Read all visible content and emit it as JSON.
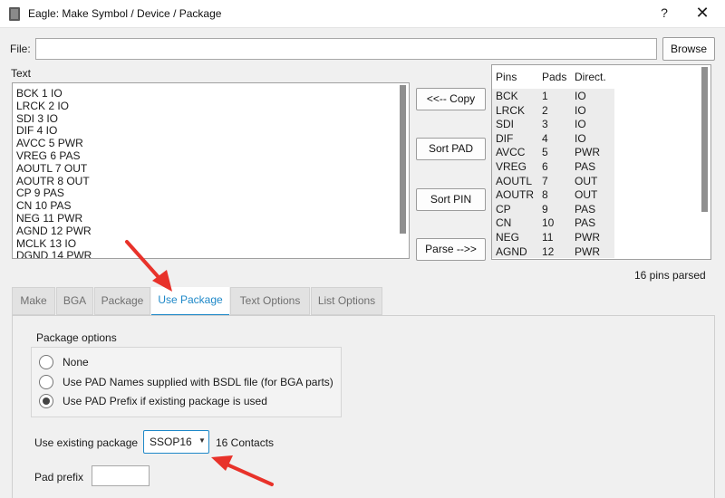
{
  "window": {
    "title": "Eagle: Make Symbol / Device / Package",
    "help_label": "?",
    "close_label": "✕"
  },
  "file": {
    "label": "File:",
    "value": "",
    "browse_label": "Browse"
  },
  "text_panel": {
    "label": "Text",
    "lines": [
      "BCK 1 IO",
      "LRCK 2 IO",
      "SDI 3 IO",
      "DIF 4 IO",
      "AVCC 5 PWR",
      "VREG 6 PAS",
      "AOUTL 7 OUT",
      "AOUTR 8 OUT",
      "CP 9 PAS",
      "CN 10 PAS",
      "NEG 11 PWR",
      "AGND 12 PWR",
      "MCLK 13 IO",
      "DGND 14 PWR"
    ]
  },
  "actions": {
    "copy_label": "<<-- Copy",
    "sort_pad_label": "Sort PAD",
    "sort_pin_label": "Sort PIN",
    "parse_label": "Parse -->>"
  },
  "pins_table": {
    "headers": [
      "Pins",
      "Pads",
      "Direct."
    ],
    "rows": [
      [
        "BCK",
        "1",
        "IO"
      ],
      [
        "LRCK",
        "2",
        "IO"
      ],
      [
        "SDI",
        "3",
        "IO"
      ],
      [
        "DIF",
        "4",
        "IO"
      ],
      [
        "AVCC",
        "5",
        "PWR"
      ],
      [
        "VREG",
        "6",
        "PAS"
      ],
      [
        "AOUTL",
        "7",
        "OUT"
      ],
      [
        "AOUTR",
        "8",
        "OUT"
      ],
      [
        "CP",
        "9",
        "PAS"
      ],
      [
        "CN",
        "10",
        "PAS"
      ],
      [
        "NEG",
        "11",
        "PWR"
      ],
      [
        "AGND",
        "12",
        "PWR"
      ]
    ]
  },
  "status": {
    "parsed": "16 pins parsed"
  },
  "tabs": [
    "Make",
    "BGA",
    "Package",
    "Use Package",
    "Text Options",
    "List Options"
  ],
  "active_tab": "Use Package",
  "package_options": {
    "title": "Package options",
    "options": [
      "None",
      "Use PAD Names supplied with BSDL file (for BGA parts)",
      "Use PAD Prefix if existing package is used"
    ],
    "selected_index": 2
  },
  "existing_package": {
    "label": "Use existing package",
    "selected": "SSOP16",
    "contacts": "16 Contacts"
  },
  "pad_prefix": {
    "label": "Pad prefix",
    "value": ""
  },
  "colors": {
    "accent": "#1e88c8",
    "arrow": "#e8322a",
    "window_bg": "#f0f0f0"
  },
  "icons": [
    "app-icon",
    "help-icon",
    "close-icon",
    "chevron-down-icon",
    "arrow-annotation"
  ]
}
